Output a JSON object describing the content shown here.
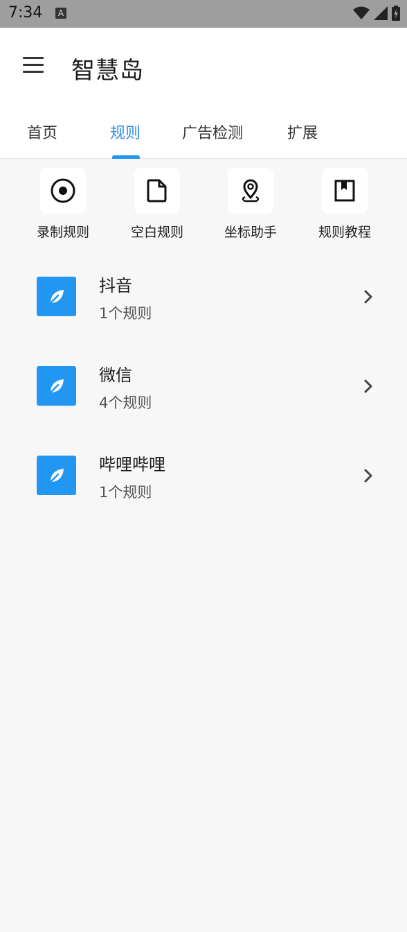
{
  "status_bar": {
    "time": "7:34",
    "notification_icon": "a-icon",
    "icons": [
      "wifi-icon",
      "signal-icon",
      "battery-charging-icon"
    ]
  },
  "app_bar": {
    "menu_icon": "hamburger-menu-icon",
    "title": "智慧岛"
  },
  "tabs": [
    {
      "label": "首页",
      "active": false
    },
    {
      "label": "规则",
      "active": true
    },
    {
      "label": "广告检测",
      "active": false
    },
    {
      "label": "扩展",
      "active": false
    }
  ],
  "quick_actions": [
    {
      "label": "录制规则",
      "icon": "record-icon"
    },
    {
      "label": "空白规则",
      "icon": "blank-file-icon"
    },
    {
      "label": "坐标助手",
      "icon": "location-pin-icon"
    },
    {
      "label": "规则教程",
      "icon": "bookmark-book-icon"
    }
  ],
  "apps": [
    {
      "name": "抖音",
      "count": "1个规则",
      "icon": "leaf-icon"
    },
    {
      "name": "微信",
      "count": "4个规则",
      "icon": "leaf-icon"
    },
    {
      "name": "哔哩哔哩",
      "count": "1个规则",
      "icon": "leaf-icon"
    }
  ],
  "colors": {
    "accent": "#2196f3",
    "active_tab_text": "#2d8fe3",
    "background": "#f7f7f7",
    "status_bar": "#9e9e9e"
  }
}
